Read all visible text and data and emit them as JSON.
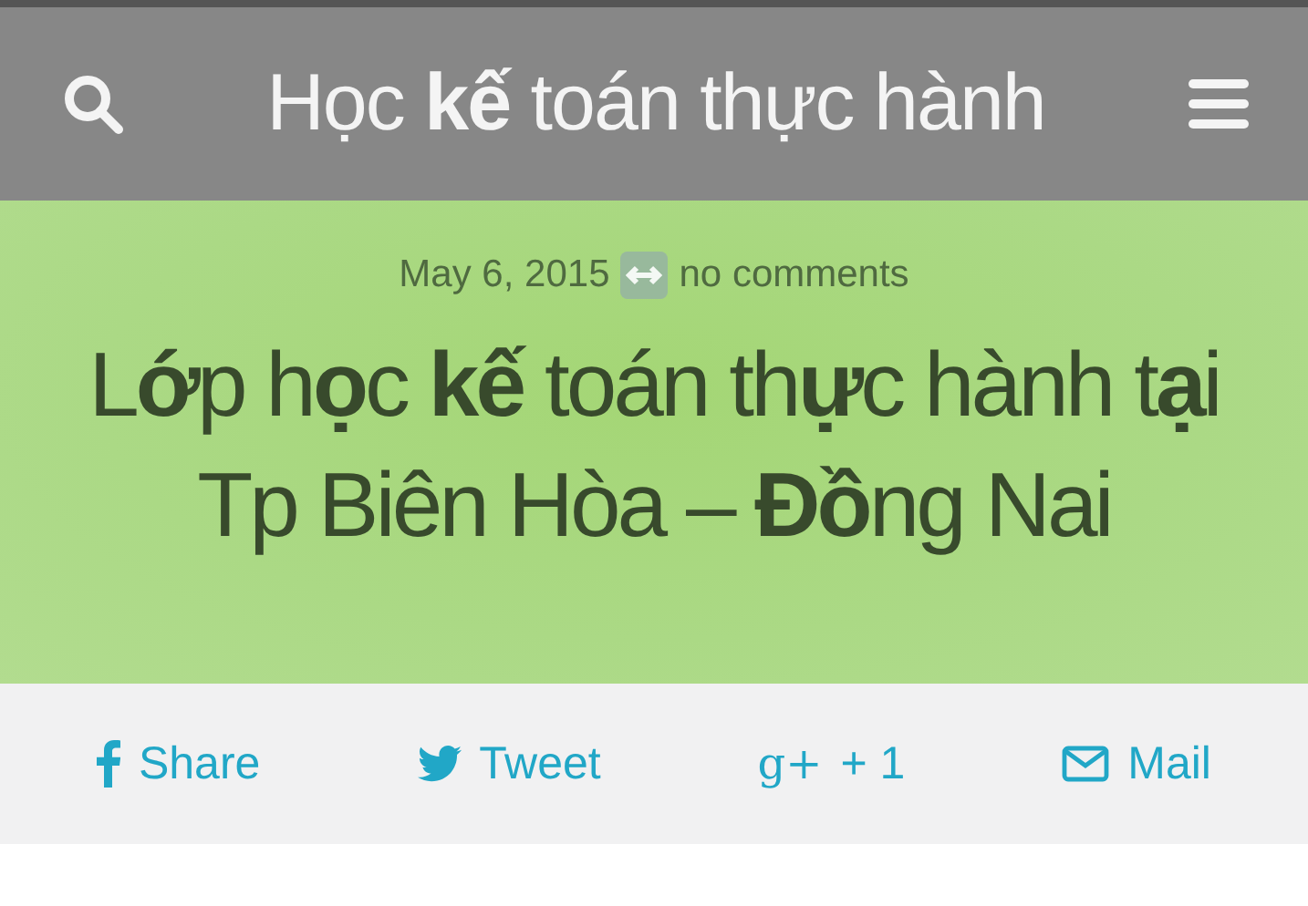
{
  "header": {
    "title": "Học **kế** toán thực hành"
  },
  "post": {
    "date": "May 6, 2015",
    "comments": "no comments",
    "title": "L**ớ**p h**ọ**c **kế** toán th**ự**c hành t**ạ**i Tp Biên Hòa – **Đồ**ng Nai"
  },
  "share": [
    {
      "kind": "facebook",
      "label": "Share"
    },
    {
      "kind": "twitter",
      "label": "Tweet"
    },
    {
      "kind": "gplus",
      "glyph": "g+",
      "label": "+ 1"
    },
    {
      "kind": "mail",
      "label": "Mail"
    }
  ]
}
